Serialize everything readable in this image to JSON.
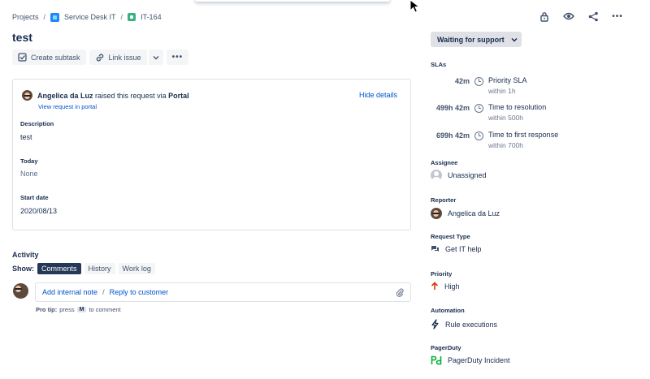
{
  "breadcrumb": {
    "projects": "Projects",
    "project_name": "Service Desk IT",
    "issue_key": "IT-164"
  },
  "issue": {
    "title": "test"
  },
  "toolbar": {
    "create_subtask": "Create subtask",
    "link_issue": "Link issue"
  },
  "request": {
    "reporter_name": "Angelica da Luz",
    "raised_text": "raised this request via",
    "channel": "Portal",
    "view_portal": "View request in portal",
    "hide_details": "Hide details"
  },
  "fields": [
    {
      "label": "Description",
      "value": "test"
    },
    {
      "label": "Today",
      "value": "None"
    },
    {
      "label": "Start date",
      "value": "2020/08/13"
    }
  ],
  "activity": {
    "title": "Activity",
    "show_label": "Show:",
    "tabs": [
      "Comments",
      "History",
      "Work log"
    ],
    "add_internal_note": "Add internal note",
    "reply_to_customer": "Reply to customer",
    "separator": "/",
    "protip_label": "Pro tip:",
    "protip_press": "press",
    "protip_key": "M",
    "protip_rest": "to comment"
  },
  "status": {
    "label": "Waiting for support"
  },
  "slas": {
    "label": "SLAs",
    "items": [
      {
        "time": "42m",
        "name": "Priority SLA",
        "target": "within 1h"
      },
      {
        "time": "499h 42m",
        "name": "Time to resolution",
        "target": "within 500h"
      },
      {
        "time": "699h 42m",
        "name": "Time to first response",
        "target": "within 700h"
      }
    ]
  },
  "details": {
    "assignee_label": "Assignee",
    "assignee_value": "Unassigned",
    "reporter_label": "Reporter",
    "reporter_value": "Angelica da Luz",
    "request_type_label": "Request Type",
    "request_type_value": "Get IT help",
    "priority_label": "Priority",
    "priority_value": "High",
    "priority_color": "#de350b",
    "automation_label": "Automation",
    "automation_value": "Rule executions",
    "pagerduty_label": "PagerDuty",
    "pagerduty_value": "PagerDuty Incident",
    "pagerduty_color": "#06ac38"
  }
}
